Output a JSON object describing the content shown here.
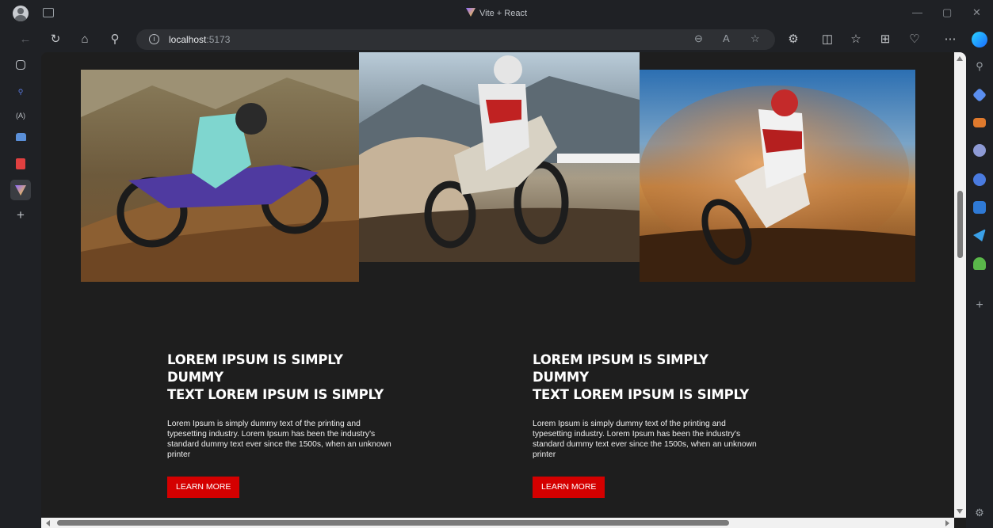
{
  "window": {
    "title": "Vite + React"
  },
  "address_bar": {
    "host": "localhost",
    "port": ":5173"
  },
  "browser": {
    "accent": "#1f2125",
    "lside_items": [
      "tab-actions-icon",
      "search-icon",
      "reader-icon",
      "collections-icon",
      "pdf-icon",
      "vite-tab-icon",
      "add-icon"
    ],
    "rside_items": [
      "search-icon",
      "shopping-icon",
      "tools-icon",
      "persona-icon",
      "games-icon",
      "outlook-icon",
      "telegram-icon",
      "tree-icon",
      "add-icon",
      "settings-icon"
    ]
  },
  "page": {
    "background": "#1e1e1e",
    "button_color": "#d40000",
    "cards": [
      {
        "heading_line1": "LOREM IPSUM IS SIMPLY",
        "heading_line2": "DUMMY",
        "heading_line3": "TEXT LOREM IPSUM IS SIMPLY",
        "body": "Lorem Ipsum is simply dummy text of the printing and typesetting industry. Lorem Ipsum has been the industry's standard dummy text ever since the 1500s, when an unknown printer",
        "button": "LEARN MORE"
      },
      {
        "heading_line1": "LOREM IPSUM IS SIMPLY",
        "heading_line2": "DUMMY",
        "heading_line3": "TEXT LOREM IPSUM IS SIMPLY",
        "body": "Lorem Ipsum is simply dummy text of the printing and typesetting industry. Lorem Ipsum has been the industry's standard dummy text ever since the 1500s, when an unknown printer",
        "button": "LEARN MORE"
      }
    ]
  }
}
